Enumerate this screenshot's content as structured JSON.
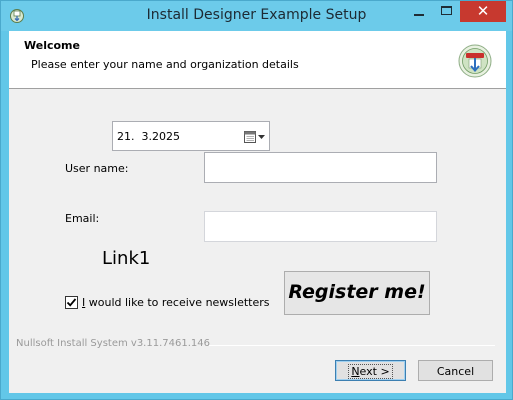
{
  "window": {
    "title": "Install Designer Example Setup",
    "close_label": "✕"
  },
  "header": {
    "title": "Welcome",
    "subtitle": "Please enter your name and organization details"
  },
  "form": {
    "date_value": "21.  3.2025",
    "username_label": "User name:",
    "email_label": "Email:",
    "username_value": "",
    "email_value": "",
    "link_text": "Link1",
    "newsletter_checked": true,
    "newsletter_prefix": "I",
    "newsletter_rest": " would like to receive newsletters",
    "register_label": "Register me!"
  },
  "footer": {
    "branding": "Nullsoft Install System v3.11.7461.146",
    "next_mnemonic": "N",
    "next_rest": "ext >",
    "cancel_label": "Cancel"
  },
  "icons": {
    "app_icon": "installer-icon",
    "header_logo": "installer-logo-icon",
    "calendar": "calendar-dropdown-icon",
    "check": "checkmark-icon"
  },
  "colors": {
    "titlebar": "#6ccbea",
    "close_button": "#c7392f",
    "dialog_bg": "#f0f0f0",
    "default_button_border": "#3c7fb1"
  }
}
